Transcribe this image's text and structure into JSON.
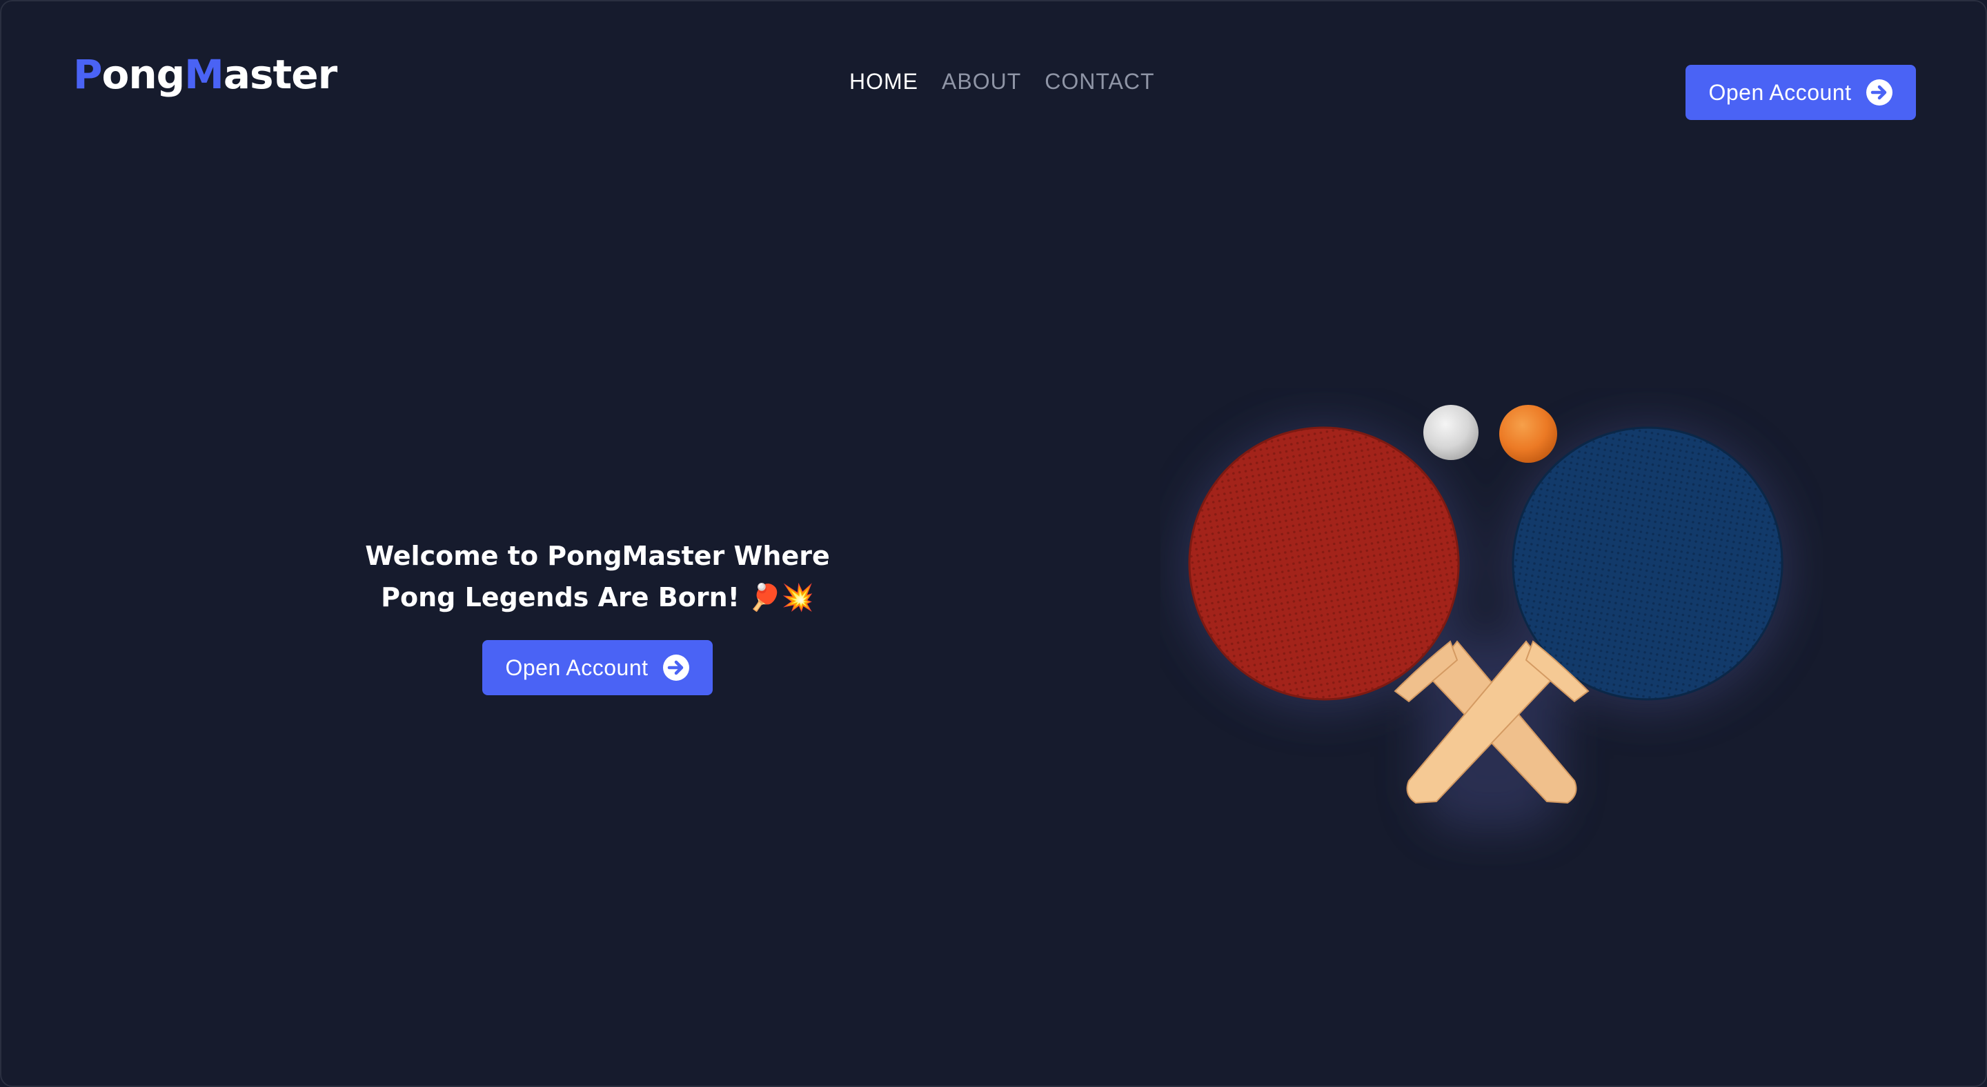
{
  "header": {
    "logo": {
      "p": "P",
      "ong": "ong",
      "m": "M",
      "aster": "aster"
    },
    "nav": [
      {
        "label": "HOME",
        "active": true
      },
      {
        "label": "ABOUT",
        "active": false
      },
      {
        "label": "CONTACT",
        "active": false
      }
    ],
    "cta_label": "Open Account",
    "cta_icon": "arrow-right-circle-icon"
  },
  "hero": {
    "title_line1": "Welcome to PongMaster Where",
    "title_line2": "Pong Legends Are Born! 🏓💥",
    "cta_label": "Open Account",
    "cta_icon": "arrow-right-circle-icon",
    "illustration": "crossed-ping-pong-paddles-with-balls"
  },
  "colors": {
    "background": "#161b2d",
    "accent": "#4a63f5",
    "text": "#ffffff",
    "nav_inactive": "#8f95a6",
    "paddle_red": "#a3231a",
    "paddle_blue": "#123a6a",
    "handle": "#f0c08c",
    "ball_white": "#d9d9d9",
    "ball_orange": "#ec7a25"
  }
}
